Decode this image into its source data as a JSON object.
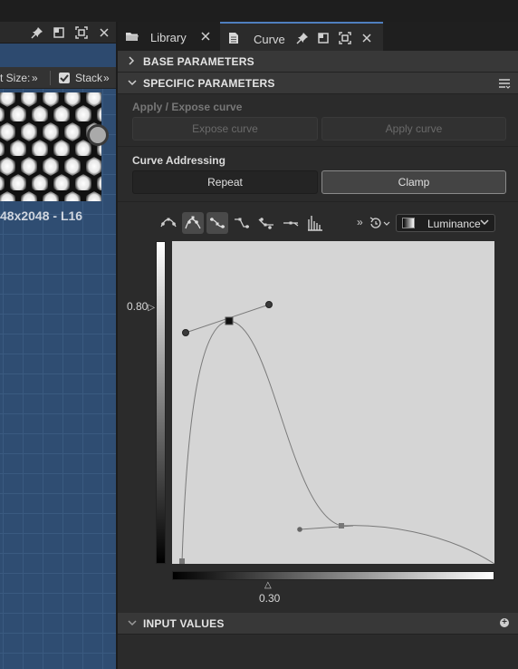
{
  "left_panel": {
    "toolbar": {
      "size_label": "t Size:",
      "overflow": "»",
      "stack_label": "Stack",
      "stack_overflow": "»"
    },
    "node_caption": "48x2048 - L16"
  },
  "tabs": [
    {
      "label": "Library",
      "icon": "folder-icon"
    },
    {
      "label": "Curve",
      "icon": "document-icon"
    }
  ],
  "sections": {
    "base": {
      "title": "BASE PARAMETERS",
      "expanded": false
    },
    "specific": {
      "title": "SPECIFIC PARAMETERS",
      "expanded": true
    },
    "input_values": {
      "title": "INPUT VALUES",
      "expanded": false
    }
  },
  "apply_expose": {
    "title": "Apply / Expose curve",
    "expose_label": "Expose curve",
    "apply_label": "Apply curve"
  },
  "addressing": {
    "title": "Curve Addressing",
    "options": [
      "Repeat",
      "Clamp"
    ],
    "selected": "Clamp"
  },
  "curve_toolbar": {
    "overflow": "»",
    "channel": "Luminance"
  },
  "readouts": {
    "y_value": "0.80",
    "x_value": "0.30"
  },
  "colors": {
    "accent": "#4f7fbf",
    "graph_bg": "#2f4d72",
    "panel_bg": "#2b2b2b",
    "header_bg": "#383838"
  }
}
